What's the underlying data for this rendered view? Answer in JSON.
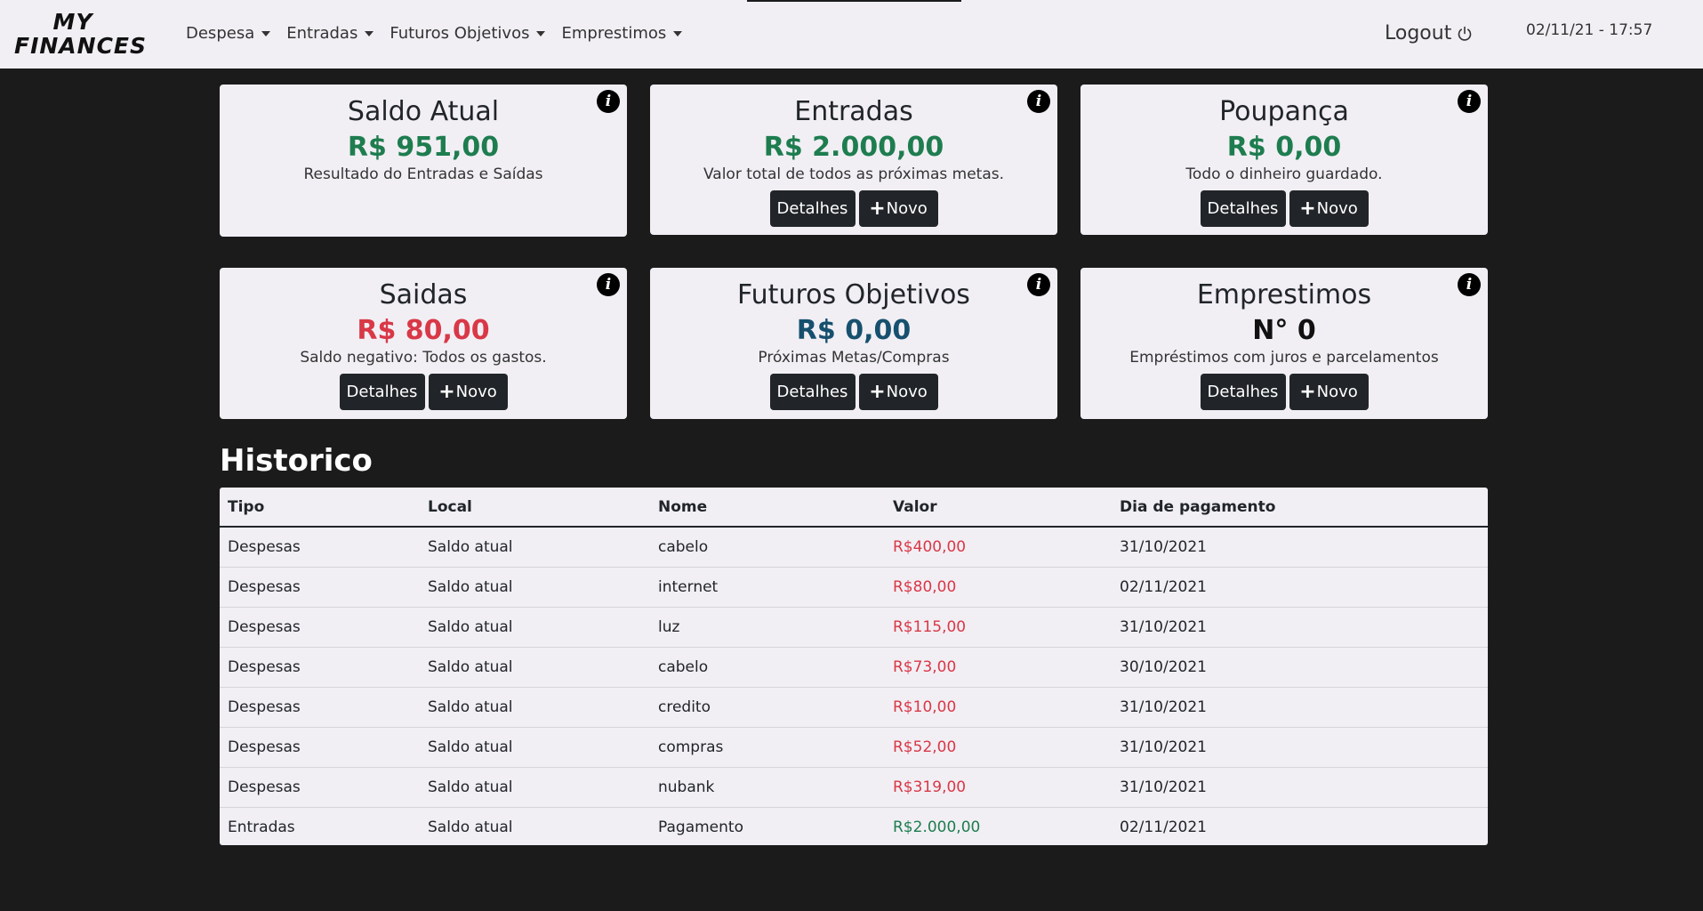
{
  "navbar": {
    "logo_line1": "MY",
    "logo_line2": "FINANCES",
    "menu": [
      "Despesa",
      "Entradas",
      "Futuros Objetivos",
      "Emprestimos"
    ],
    "logout_label": "Logout",
    "datetime": "02/11/21 - 17:57"
  },
  "buttons": {
    "details_label": "Detalhes",
    "new_label": "Novo"
  },
  "cards": [
    {
      "title": "Saldo Atual",
      "value": "R$ 951,00",
      "color": "#1e7d4f",
      "description": "Resultado do Entradas e Saídas"
    },
    {
      "title": "Entradas",
      "value": "R$ 2.000,00",
      "color": "#1e7d4f",
      "description": "Valor total de todos as próximas metas."
    },
    {
      "title": "Poupança",
      "value": "R$ 0,00",
      "color": "#1e7d4f",
      "description": "Todo o dinheiro guardado."
    },
    {
      "title": "Saidas",
      "value": "R$ 80,00",
      "color": "#d93847",
      "description": "Saldo negativo: Todos os gastos."
    },
    {
      "title": "Futuros Objetivos",
      "value": "R$ 0,00",
      "color": "#17506e",
      "description": "Próximas Metas/Compras"
    },
    {
      "title": "Emprestimos",
      "value": "N° 0",
      "color": "#111111",
      "description": "Empréstimos com juros e parcelamentos"
    }
  ],
  "historico": {
    "title": "Historico",
    "columns": [
      "Tipo",
      "Local",
      "Nome",
      "Valor",
      "Dia de pagamento"
    ],
    "rows": [
      {
        "tipo": "Despesas",
        "local": "Saldo atual",
        "nome": "cabelo",
        "valor": "R$400,00",
        "dia": "31/10/2021"
      },
      {
        "tipo": "Despesas",
        "local": "Saldo atual",
        "nome": "internet",
        "valor": "R$80,00",
        "dia": "02/11/2021"
      },
      {
        "tipo": "Despesas",
        "local": "Saldo atual",
        "nome": "luz",
        "valor": "R$115,00",
        "dia": "31/10/2021"
      },
      {
        "tipo": "Despesas",
        "local": "Saldo atual",
        "nome": "cabelo",
        "valor": "R$73,00",
        "dia": "30/10/2021"
      },
      {
        "tipo": "Despesas",
        "local": "Saldo atual",
        "nome": "credito",
        "valor": "R$10,00",
        "dia": "31/10/2021"
      },
      {
        "tipo": "Despesas",
        "local": "Saldo atual",
        "nome": "compras",
        "valor": "R$52,00",
        "dia": "31/10/2021"
      },
      {
        "tipo": "Despesas",
        "local": "Saldo atual",
        "nome": "nubank",
        "valor": "R$319,00",
        "dia": "31/10/2021"
      },
      {
        "tipo": "Entradas",
        "local": "Saldo atual",
        "nome": "Pagamento",
        "valor": "R$2.000,00",
        "dia": "02/11/2021"
      }
    ]
  }
}
